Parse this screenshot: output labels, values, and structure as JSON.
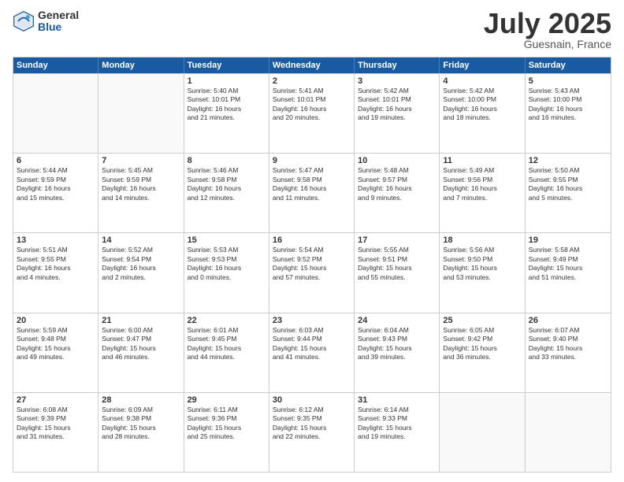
{
  "header": {
    "logo_general": "General",
    "logo_blue": "Blue",
    "title": "July 2025",
    "location": "Guesnain, France"
  },
  "calendar": {
    "days_of_week": [
      "Sunday",
      "Monday",
      "Tuesday",
      "Wednesday",
      "Thursday",
      "Friday",
      "Saturday"
    ],
    "weeks": [
      [
        {
          "day": "",
          "empty": true
        },
        {
          "day": "",
          "empty": true
        },
        {
          "day": "1",
          "sunrise": "5:40 AM",
          "sunset": "10:01 PM",
          "daylight": "16 hours and 21 minutes."
        },
        {
          "day": "2",
          "sunrise": "5:41 AM",
          "sunset": "10:01 PM",
          "daylight": "16 hours and 20 minutes."
        },
        {
          "day": "3",
          "sunrise": "5:42 AM",
          "sunset": "10:01 PM",
          "daylight": "16 hours and 19 minutes."
        },
        {
          "day": "4",
          "sunrise": "5:42 AM",
          "sunset": "10:00 PM",
          "daylight": "16 hours and 18 minutes."
        },
        {
          "day": "5",
          "sunrise": "5:43 AM",
          "sunset": "10:00 PM",
          "daylight": "16 hours and 16 minutes."
        }
      ],
      [
        {
          "day": "6",
          "sunrise": "5:44 AM",
          "sunset": "9:59 PM",
          "daylight": "16 hours and 15 minutes."
        },
        {
          "day": "7",
          "sunrise": "5:45 AM",
          "sunset": "9:59 PM",
          "daylight": "16 hours and 14 minutes."
        },
        {
          "day": "8",
          "sunrise": "5:46 AM",
          "sunset": "9:58 PM",
          "daylight": "16 hours and 12 minutes."
        },
        {
          "day": "9",
          "sunrise": "5:47 AM",
          "sunset": "9:58 PM",
          "daylight": "16 hours and 11 minutes."
        },
        {
          "day": "10",
          "sunrise": "5:48 AM",
          "sunset": "9:57 PM",
          "daylight": "16 hours and 9 minutes."
        },
        {
          "day": "11",
          "sunrise": "5:49 AM",
          "sunset": "9:56 PM",
          "daylight": "16 hours and 7 minutes."
        },
        {
          "day": "12",
          "sunrise": "5:50 AM",
          "sunset": "9:55 PM",
          "daylight": "16 hours and 5 minutes."
        }
      ],
      [
        {
          "day": "13",
          "sunrise": "5:51 AM",
          "sunset": "9:55 PM",
          "daylight": "16 hours and 4 minutes."
        },
        {
          "day": "14",
          "sunrise": "5:52 AM",
          "sunset": "9:54 PM",
          "daylight": "16 hours and 2 minutes."
        },
        {
          "day": "15",
          "sunrise": "5:53 AM",
          "sunset": "9:53 PM",
          "daylight": "16 hours and 0 minutes."
        },
        {
          "day": "16",
          "sunrise": "5:54 AM",
          "sunset": "9:52 PM",
          "daylight": "15 hours and 57 minutes."
        },
        {
          "day": "17",
          "sunrise": "5:55 AM",
          "sunset": "9:51 PM",
          "daylight": "15 hours and 55 minutes."
        },
        {
          "day": "18",
          "sunrise": "5:56 AM",
          "sunset": "9:50 PM",
          "daylight": "15 hours and 53 minutes."
        },
        {
          "day": "19",
          "sunrise": "5:58 AM",
          "sunset": "9:49 PM",
          "daylight": "15 hours and 51 minutes."
        }
      ],
      [
        {
          "day": "20",
          "sunrise": "5:59 AM",
          "sunset": "9:48 PM",
          "daylight": "15 hours and 49 minutes."
        },
        {
          "day": "21",
          "sunrise": "6:00 AM",
          "sunset": "9:47 PM",
          "daylight": "15 hours and 46 minutes."
        },
        {
          "day": "22",
          "sunrise": "6:01 AM",
          "sunset": "9:45 PM",
          "daylight": "15 hours and 44 minutes."
        },
        {
          "day": "23",
          "sunrise": "6:03 AM",
          "sunset": "9:44 PM",
          "daylight": "15 hours and 41 minutes."
        },
        {
          "day": "24",
          "sunrise": "6:04 AM",
          "sunset": "9:43 PM",
          "daylight": "15 hours and 39 minutes."
        },
        {
          "day": "25",
          "sunrise": "6:05 AM",
          "sunset": "9:42 PM",
          "daylight": "15 hours and 36 minutes."
        },
        {
          "day": "26",
          "sunrise": "6:07 AM",
          "sunset": "9:40 PM",
          "daylight": "15 hours and 33 minutes."
        }
      ],
      [
        {
          "day": "27",
          "sunrise": "6:08 AM",
          "sunset": "9:39 PM",
          "daylight": "15 hours and 31 minutes."
        },
        {
          "day": "28",
          "sunrise": "6:09 AM",
          "sunset": "9:38 PM",
          "daylight": "15 hours and 28 minutes."
        },
        {
          "day": "29",
          "sunrise": "6:11 AM",
          "sunset": "9:36 PM",
          "daylight": "15 hours and 25 minutes."
        },
        {
          "day": "30",
          "sunrise": "6:12 AM",
          "sunset": "9:35 PM",
          "daylight": "15 hours and 22 minutes."
        },
        {
          "day": "31",
          "sunrise": "6:14 AM",
          "sunset": "9:33 PM",
          "daylight": "15 hours and 19 minutes."
        },
        {
          "day": "",
          "empty": true
        },
        {
          "day": "",
          "empty": true
        }
      ]
    ]
  }
}
